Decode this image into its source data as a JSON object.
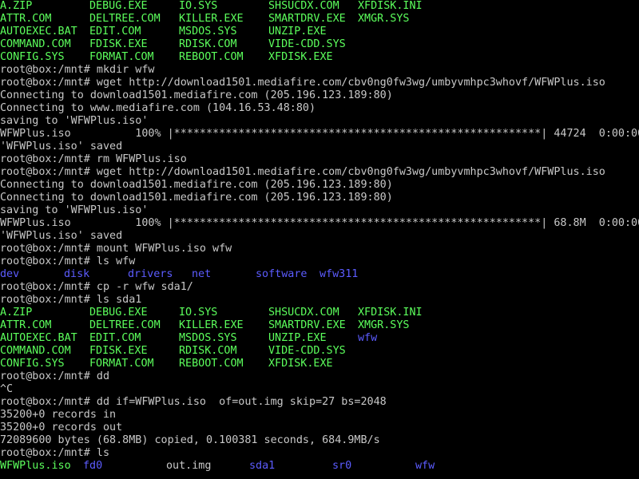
{
  "screen": {
    "colors": {
      "background": "#000000",
      "text": "#c8c8c8",
      "file": "#5cff5c",
      "directory": "#5c5cff"
    }
  },
  "listing_a": {
    "rows": [
      [
        "A.ZIP",
        "DEBUG.EXE",
        "IO.SYS",
        "SHSUCDX.COM",
        "XFDISK.INI"
      ],
      [
        "ATTR.COM",
        "DELTREE.COM",
        "KILLER.EXE",
        "SMARTDRV.EXE",
        "XMGR.SYS"
      ],
      [
        "AUTOEXEC.BAT",
        "EDIT.COM",
        "MSDOS.SYS",
        "UNZIP.EXE",
        ""
      ],
      [
        "COMMAND.COM",
        "FDISK.EXE",
        "RDISK.COM",
        "VIDE-CDD.SYS",
        ""
      ],
      [
        "CONFIG.SYS",
        "FORMAT.COM",
        "REBOOT.COM",
        "XFDISK.EXE",
        ""
      ]
    ]
  },
  "block1": {
    "l1": "root@box:/mnt# mkdir wfw",
    "l2": "root@box:/mnt# wget http://download1501.mediafire.com/cbv0ng0fw3wg/umbyvmhpc3whovf/WFWPlus.iso",
    "l3": "Connecting to download1501.mediafire.com (205.196.123.189:80)",
    "l4": "Connecting to www.mediafire.com (104.16.53.48:80)",
    "l5": "saving to 'WFWPlus.iso'",
    "l6": "WFWPlus.iso          100% |*********************************************************| 44724  0:00:00 ETA",
    "l7": "'WFWPlus.iso' saved",
    "l8": "root@box:/mnt# rm WFWPlus.iso",
    "l9": "root@box:/mnt# wget http://download1501.mediafire.com/cbv0ng0fw3wg/umbyvmhpc3whovf/WFWPlus.iso",
    "l10": "Connecting to download1501.mediafire.com (205.196.123.189:80)",
    "l11": "Connecting to download1501.mediafire.com (205.196.123.189:80)",
    "l12": "saving to 'WFWPlus.iso'",
    "l13": "WFWPlus.iso          100% |*********************************************************| 68.8M  0:00:00 ETA",
    "l14": "'WFWPlus.iso' saved",
    "l15": "root@box:/mnt# mount WFWPlus.iso wfw",
    "l16": "root@box:/mnt# ls wfw"
  },
  "wfw_dirs": [
    "dev",
    "disk",
    "drivers",
    "net",
    "software",
    "wfw311"
  ],
  "block2": {
    "l1": "root@box:/mnt# cp -r wfw sda1/",
    "l2": "root@box:/mnt# ls sda1"
  },
  "listing_b": {
    "rows": [
      [
        "A.ZIP",
        "DEBUG.EXE",
        "IO.SYS",
        "SHSUCDX.COM",
        "XFDISK.INI"
      ],
      [
        "ATTR.COM",
        "DELTREE.COM",
        "KILLER.EXE",
        "SMARTDRV.EXE",
        "XMGR.SYS"
      ],
      [
        "AUTOEXEC.BAT",
        "EDIT.COM",
        "MSDOS.SYS",
        "UNZIP.EXE",
        "wfw"
      ],
      [
        "COMMAND.COM",
        "FDISK.EXE",
        "RDISK.COM",
        "VIDE-CDD.SYS",
        ""
      ],
      [
        "CONFIG.SYS",
        "FORMAT.COM",
        "REBOOT.COM",
        "XFDISK.EXE",
        ""
      ]
    ]
  },
  "block3": {
    "l1": "root@box:/mnt# dd",
    "l2": "^C",
    "l3": "root@box:/mnt# dd if=WFWPlus.iso  of=out.img skip=27 bs=2048",
    "l4": "35200+0 records in",
    "l5": "35200+0 records out",
    "l6": "72089600 bytes (68.8MB) copied, 0.100381 seconds, 684.9MB/s",
    "l7": "root@box:/mnt# ls"
  },
  "final_ls": [
    {
      "name": "WFWPlus.iso",
      "kind": "file"
    },
    {
      "name": "fd0",
      "kind": "dir"
    },
    {
      "name": "out.img",
      "kind": "plain"
    },
    {
      "name": "sda1",
      "kind": "dir"
    },
    {
      "name": "sr0",
      "kind": "dir"
    },
    {
      "name": "wfw",
      "kind": "dir"
    }
  ]
}
